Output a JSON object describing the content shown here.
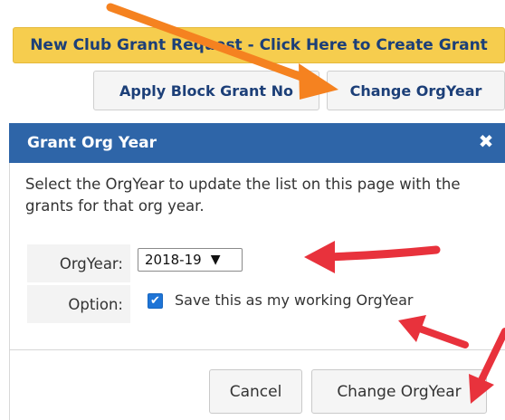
{
  "toolbar": {
    "new_grant_label": "New Club Grant Request - Click Here to Create Grant",
    "apply_block_label": "Apply Block Grant No",
    "change_orgyear_label": "Change OrgYear"
  },
  "dialog": {
    "title": "Grant Org Year",
    "close_glyph": "✖",
    "description": "Select the OrgYear to update the list on this page with the grants for that org year.",
    "orgyear_label": "OrgYear:",
    "orgyear_value": "2018-19",
    "option_label": "Option:",
    "save_working_label": "Save this as my working OrgYear",
    "save_working_checked": true,
    "cancel_label": "Cancel",
    "submit_label": "Change OrgYear"
  },
  "colors": {
    "header": "#2e65a8",
    "primary_button": "#f6cd4e",
    "annotation_orange": "#f58220",
    "annotation_red": "#e8323c"
  }
}
